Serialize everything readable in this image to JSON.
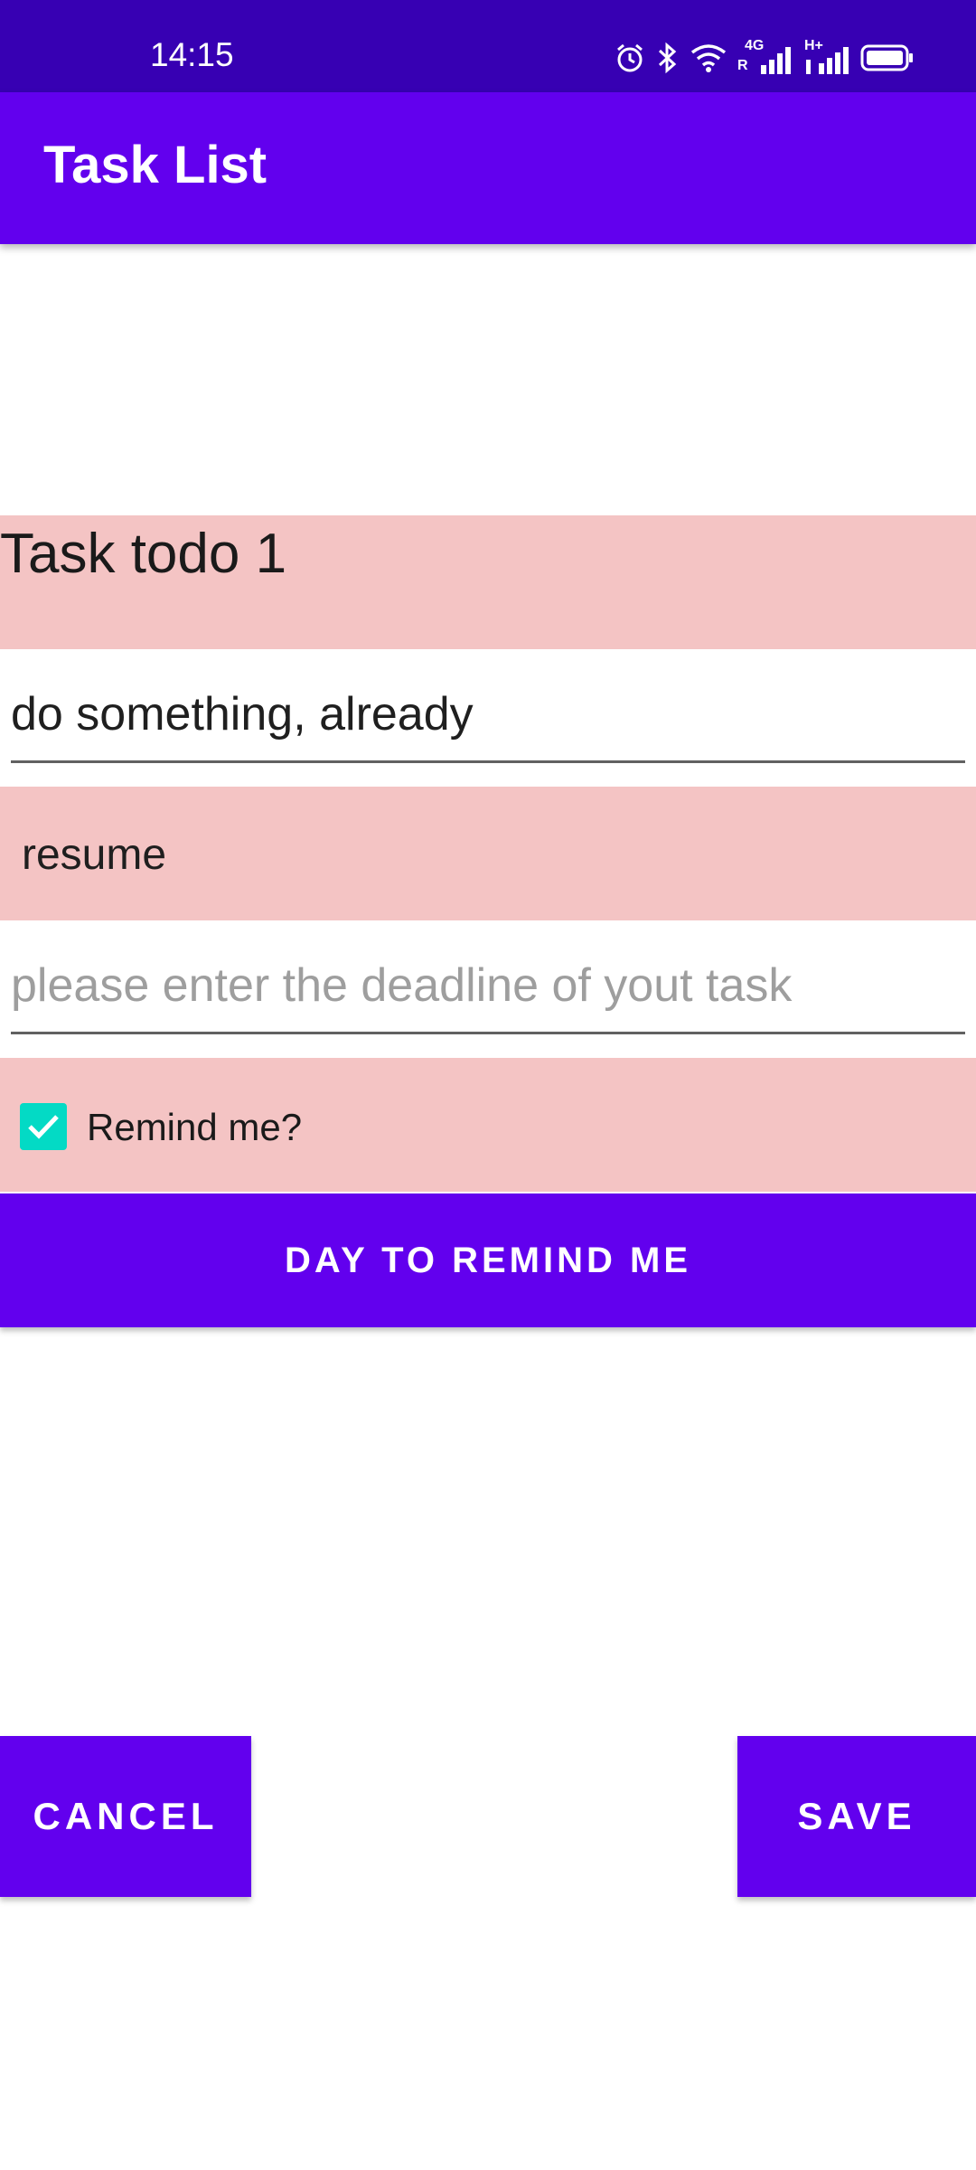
{
  "status_bar": {
    "time": "14:15",
    "network_label": "4G",
    "network_sub": "R",
    "second_network_label": "H+",
    "icons": [
      "alarm-icon",
      "bluetooth-icon",
      "wifi-icon",
      "signal-icon",
      "signal-icon",
      "battery-icon"
    ]
  },
  "app_bar": {
    "title": "Task List"
  },
  "task": {
    "name": "Task todo 1"
  },
  "description_field": {
    "value": "do something, already"
  },
  "category_spinner": {
    "value": "resume"
  },
  "deadline_field": {
    "placeholder": "please enter the deadline of yout task"
  },
  "reminder": {
    "label": "Remind me?",
    "checked": true
  },
  "buttons": {
    "day_to_remind": "DAY TO REMIND ME",
    "cancel": "CANCEL",
    "save": "SAVE"
  },
  "colors": {
    "status_bar": "#3700b3",
    "primary": "#6200ee",
    "row_background": "#f4c4c4",
    "checkbox_accent": "#03dac5"
  }
}
